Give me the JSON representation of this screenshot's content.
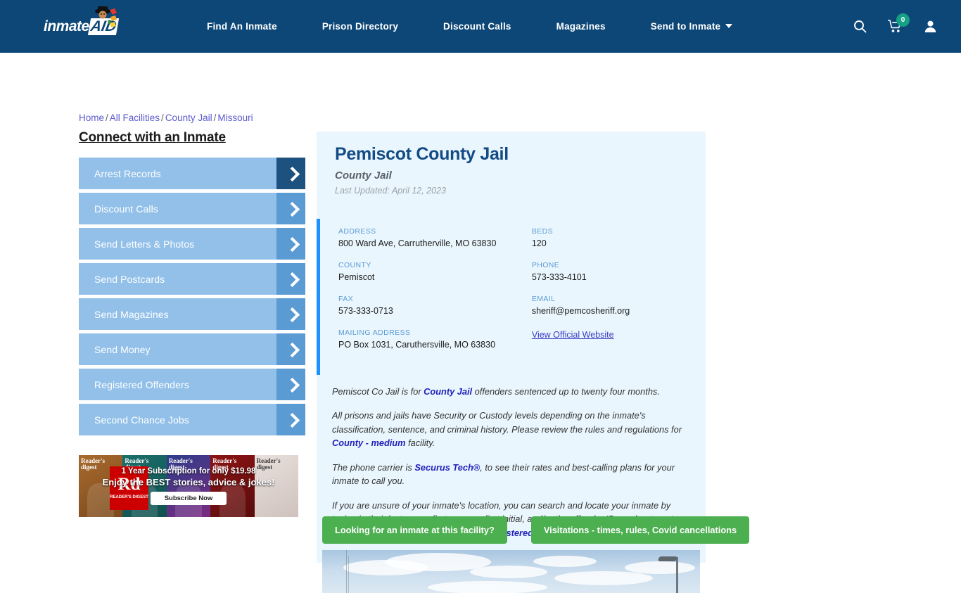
{
  "header": {
    "logo": {
      "text": "inmate",
      "badge": "AID",
      "alt": "inmateaid-logo"
    },
    "nav": [
      {
        "label": "Find An Inmate",
        "dropdown": false
      },
      {
        "label": "Prison Directory",
        "dropdown": false
      },
      {
        "label": "Discount Calls",
        "dropdown": false
      },
      {
        "label": "Magazines",
        "dropdown": false
      },
      {
        "label": "Send to Inmate",
        "dropdown": true
      }
    ],
    "icons": {
      "search": "search-icon",
      "cart": "cart-icon",
      "cart_count": "0",
      "account": "user-icon"
    },
    "colors": {
      "background": "#0d4777",
      "badge": "#16a085"
    }
  },
  "breadcrumb": {
    "items": [
      "Home",
      "All Facilities",
      "County Jail",
      "Missouri"
    ],
    "separator": "/"
  },
  "sidebar": {
    "title": "Connect with an Inmate",
    "items": [
      {
        "label": "Arrest Records",
        "active": true
      },
      {
        "label": "Discount Calls",
        "active": false
      },
      {
        "label": "Send Letters & Photos",
        "active": false
      },
      {
        "label": "Send Postcards",
        "active": false
      },
      {
        "label": "Send Magazines",
        "active": false
      },
      {
        "label": "Send Money",
        "active": false
      },
      {
        "label": "Registered Offenders",
        "active": false
      },
      {
        "label": "Second Chance Jobs",
        "active": false
      }
    ],
    "colors": {
      "button": "#92c0e9",
      "arrow": "#5a9bd4",
      "arrow_active": "#1d5180"
    }
  },
  "ad": {
    "brand": "Rd",
    "brand_sub": "READER'S DIGEST",
    "line1": "1 Year Subscription for only $19.98",
    "line2": "Enjoy the BEST stories, advice & jokes!",
    "cta": "Subscribe Now",
    "covers": [
      "Reader's digest",
      "Reader's digest",
      "Reader's digest",
      "Reader's digest",
      "Reader's digest"
    ]
  },
  "facility": {
    "name": "Pemiscot County Jail",
    "type": "County Jail",
    "updated": "Last Updated: April 12, 2023",
    "details_left": [
      {
        "label": "ADDRESS",
        "value": "800 Ward Ave, Carrutherville, MO 63830"
      },
      {
        "label": "COUNTY",
        "value": "Pemiscot"
      },
      {
        "label": "FAX",
        "value": "573-333-0713"
      },
      {
        "label": "MAILING ADDRESS",
        "value": "PO Box 1031, Caruthersville, MO 63830"
      }
    ],
    "details_right": [
      {
        "label": "BEDS",
        "value": "120"
      },
      {
        "label": "PHONE",
        "value": "573-333-4101"
      },
      {
        "label": "EMAIL",
        "value": "sheriff@pemcosheriff.org"
      }
    ],
    "website_link": "View Official Website"
  },
  "description": {
    "p1_a": "Pemiscot Co Jail is for ",
    "p1_link": "County Jail",
    "p1_b": " offenders sentenced up to twenty four months.",
    "p2_a": "All prisons and jails have Security or Custody levels depending on the inmate's classification, sentence, and criminal history. Please review the rules and regulations for ",
    "p2_link": "County - medium",
    "p2_b": " facility.",
    "p3_a": "The phone carrier is ",
    "p3_link": "Securus Tech®",
    "p3_b": ", to see their rates and best-calling plans for your inmate to call you.",
    "p4_a": "If you are unsure of your inmate's location, you can search and locate your inmate by typing in their last name, first name or first initial, and/or the offender ID number to get their accurate information immediately ",
    "p4_link": "Registered Offenders",
    "p4_b": ""
  },
  "actions": {
    "inmate_search": "Looking for an inmate at this facility?",
    "visitations": "Visitations - times, rules, Covid cancellations",
    "color": "#4caf50"
  },
  "photo": {
    "alt": "facility-exterior-photo"
  }
}
